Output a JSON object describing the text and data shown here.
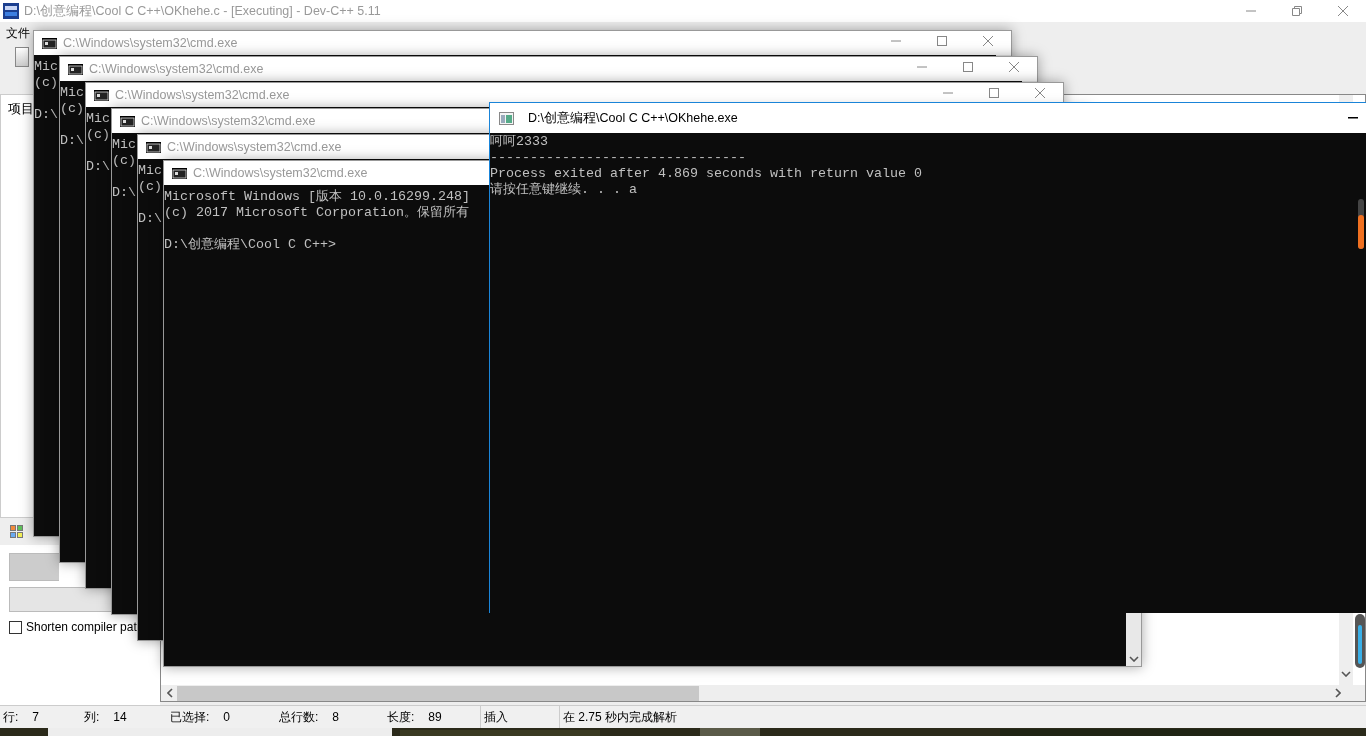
{
  "ide": {
    "title": "D:\\创意编程\\Cool C C++\\OKhehe.c - [Executing] - Dev-C++ 5.11",
    "menu": [
      "文件"
    ],
    "project_tab": "项目",
    "compiler_panel": {
      "checkbox": {
        "label": "Shorten compiler pat",
        "checked": false
      }
    },
    "status_bar": [
      {
        "label": "行:",
        "value": "7"
      },
      {
        "label": "列:",
        "value": "14"
      },
      {
        "label": "已选择:",
        "value": "0"
      },
      {
        "label": "总行数:",
        "value": "8"
      },
      {
        "label": "长度:",
        "value": "89"
      },
      {
        "text": "插入"
      },
      {
        "text": "在 2.75 秒内完成解析"
      }
    ],
    "side_slider": {
      "level": 0.85
    }
  },
  "cmd_windows": [
    {
      "title": "C:\\Windows\\system32\\cmd.exe",
      "lines": [
        "Mic",
        "(c)"
      ],
      "prompt": "D:\\"
    },
    {
      "title": "C:\\Windows\\system32\\cmd.exe",
      "lines": [
        "Mic",
        "(c)"
      ],
      "prompt": "D:\\"
    },
    {
      "title": "C:\\Windows\\system32\\cmd.exe",
      "lines": [
        "Mic",
        "(c)"
      ],
      "prompt": "D:\\"
    },
    {
      "title": "C:\\Windows\\system32\\cmd.exe",
      "lines": [
        "Mic",
        "(c)"
      ],
      "prompt": "D:\\"
    },
    {
      "title": "C:\\Windows\\system32\\cmd.exe",
      "lines": [
        "Mic",
        "(c)"
      ],
      "prompt": "D:\\"
    },
    {
      "title": "C:\\Windows\\system32\\cmd.exe",
      "lines": [
        "Microsoft Windows [版本 10.0.16299.248]",
        "(c) 2017 Microsoft Corporation。保留所有"
      ],
      "prompt": "D:\\创意编程\\Cool C C++>"
    }
  ],
  "exe_window": {
    "title": "D:\\创意编程\\Cool C C++\\OKhehe.exe",
    "lines": [
      "呵呵2333",
      "--------------------------------",
      "Process exited after 4.869 seconds with return value 0",
      "请按任意键继续. . . a"
    ]
  }
}
